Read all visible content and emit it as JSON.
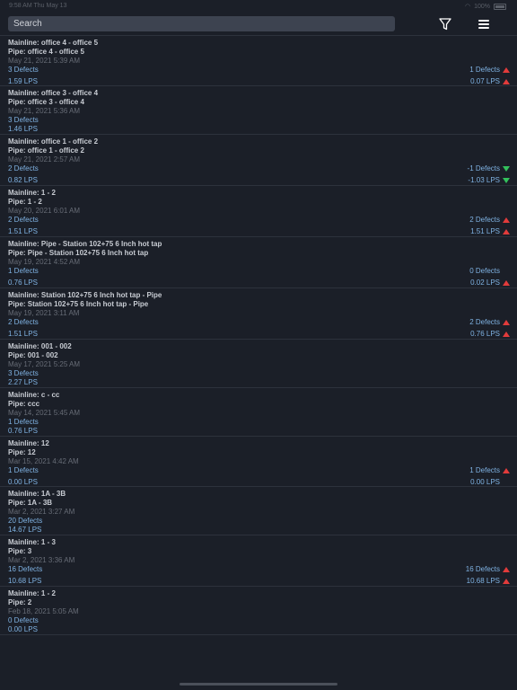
{
  "status_bar": {
    "time": "9:58 AM  Thu May 13",
    "battery": "100%"
  },
  "search": {
    "placeholder": "Search"
  },
  "icons": {
    "filter": "filter-icon",
    "menu": "hamburger-menu-icon"
  },
  "colors": {
    "background": "#1b1f28",
    "value_blue": "#7fb2e2",
    "up_red": "#e23b3b",
    "down_green": "#33c15c"
  },
  "items": [
    {
      "mainline": "Mainline: office 4 - office 5",
      "pipe": "Pipe: office 4 - office 5",
      "date": "May 21, 2021 5:39 AM",
      "defects": "3 Defects",
      "lps": "1.59 LPS",
      "delta_defects": "1 Defects",
      "delta_defects_trend": "up",
      "delta_lps": "0.07 LPS",
      "delta_lps_trend": "up"
    },
    {
      "mainline": "Mainline: office 3 - office 4",
      "pipe": "Pipe: office 3 - office 4",
      "date": "May 21, 2021 5:36 AM",
      "defects": "3 Defects",
      "lps": "1.46 LPS"
    },
    {
      "mainline": "Mainline: office 1 - office 2",
      "pipe": "Pipe: office 1 - office 2",
      "date": "May 21, 2021 2:57 AM",
      "defects": "2 Defects",
      "lps": "0.82 LPS",
      "delta_defects": "-1 Defects",
      "delta_defects_trend": "down",
      "delta_lps": "-1.03 LPS",
      "delta_lps_trend": "down"
    },
    {
      "mainline": "Mainline: 1 - 2",
      "pipe": "Pipe: 1 - 2",
      "date": "May 20, 2021 6:01 AM",
      "defects": "2 Defects",
      "lps": "1.51 LPS",
      "delta_defects": "2 Defects",
      "delta_defects_trend": "up",
      "delta_lps": "1.51 LPS",
      "delta_lps_trend": "up"
    },
    {
      "mainline": "Mainline: Pipe - Station 102+75 6 Inch hot tap",
      "pipe": "Pipe: Pipe - Station 102+75 6 Inch hot tap",
      "date": "May 19, 2021 4:52 AM",
      "defects": "1 Defects",
      "lps": "0.76 LPS",
      "delta_defects": "0 Defects",
      "delta_defects_trend": "none",
      "delta_lps": "0.02 LPS",
      "delta_lps_trend": "up"
    },
    {
      "mainline": "Mainline: Station 102+75 6 Inch hot tap - Pipe",
      "pipe": "Pipe: Station 102+75 6 Inch hot tap - Pipe",
      "date": "May 19, 2021 3:11 AM",
      "defects": "2 Defects",
      "lps": "1.51 LPS",
      "delta_defects": "2 Defects",
      "delta_defects_trend": "up",
      "delta_lps": "0.76 LPS",
      "delta_lps_trend": "up"
    },
    {
      "mainline": "Mainline: 001 - 002",
      "pipe": "Pipe: 001 - 002",
      "date": "May 17, 2021 5:25 AM",
      "defects": "3 Defects",
      "lps": "2.27 LPS"
    },
    {
      "mainline": "Mainline: c - cc",
      "pipe": "Pipe: ccc",
      "date": "May 14, 2021 5:45 AM",
      "defects": "1 Defects",
      "lps": "0.76 LPS"
    },
    {
      "mainline": "Mainline: 12",
      "pipe": "Pipe: 12",
      "date": "Mar 15, 2021 4:42 AM",
      "defects": "1 Defects",
      "lps": "0.00 LPS",
      "delta_defects": "1 Defects",
      "delta_defects_trend": "up",
      "delta_lps": "0.00 LPS",
      "delta_lps_trend": "none"
    },
    {
      "mainline": "Mainline: 1A - 3B",
      "pipe": "Pipe: 1A - 3B",
      "date": "Mar 2, 2021 3:27 AM",
      "defects": "20 Defects",
      "lps": "14.67 LPS"
    },
    {
      "mainline": "Mainline: 1 - 3",
      "pipe": "Pipe: 3",
      "date": "Mar 2, 2021 3:36 AM",
      "defects": "16 Defects",
      "lps": "10.68 LPS",
      "delta_defects": "16 Defects",
      "delta_defects_trend": "up",
      "delta_lps": "10.68 LPS",
      "delta_lps_trend": "up"
    },
    {
      "mainline": "Mainline: 1 - 2",
      "pipe": "Pipe: 2",
      "date": "Feb 18, 2021 5:05 AM",
      "defects": "0 Defects",
      "lps": "0.00 LPS"
    }
  ]
}
